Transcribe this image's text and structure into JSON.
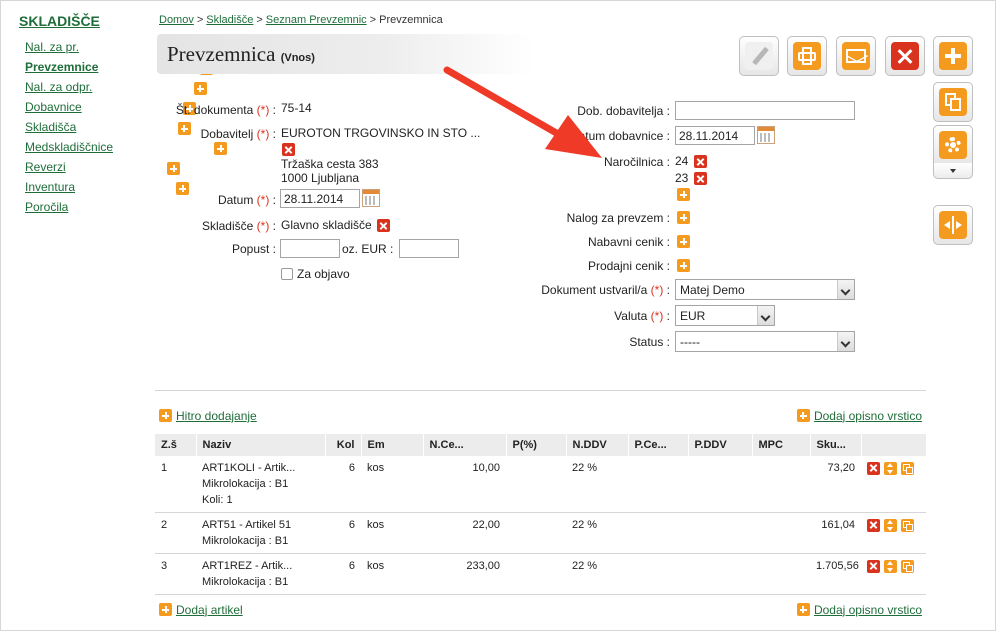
{
  "sidebar": {
    "title": "SKLADIŠČE",
    "items": [
      {
        "label": "Nal. za pr.",
        "plus": true,
        "active": false
      },
      {
        "label": "Prevzemnice",
        "plus": true,
        "active": true
      },
      {
        "label": "Nal. za odpr.",
        "plus": true,
        "active": false
      },
      {
        "label": "Dobavnice",
        "plus": true,
        "active": false
      },
      {
        "label": "Skladišča",
        "plus": true,
        "active": false
      },
      {
        "label": "Medskladiščnice",
        "plus": true,
        "active": false
      },
      {
        "label": "Reverzi",
        "plus": true,
        "active": false
      },
      {
        "label": "Inventura",
        "plus": true,
        "active": false
      },
      {
        "label": "Poročila",
        "plus": false,
        "active": false
      }
    ]
  },
  "breadcrumb": {
    "home": "Domov",
    "warehouse": "Skladišče",
    "list": "Seznam Prevzemnic",
    "current": "Prevzemnica",
    "separator": ">"
  },
  "page": {
    "title": "Prevzemnica",
    "subtitle": "(Vnos)"
  },
  "toolbar": {
    "edit_icon": "pencil-icon",
    "print_icon": "printer-icon",
    "email_icon": "envelope-icon",
    "delete_icon": "close-icon",
    "add_icon": "plus-icon",
    "copy_icon": "copy-icon",
    "settings_icon": "gear-icon",
    "split_icon": "split-icon"
  },
  "form": {
    "required_mark": "(*)",
    "doc_number": {
      "label": "Št. dokumenta",
      "value": "75-14"
    },
    "supplier": {
      "label": "Dobavitelj",
      "name": "EUROTON TRGOVINSKO IN STO ...",
      "address_line1": "Tržaška cesta 383",
      "address_line2": "1000 Ljubljana"
    },
    "date": {
      "label": "Datum",
      "value": "28.11.2014"
    },
    "warehouse": {
      "label": "Skladišče",
      "value": "Glavno skladišče"
    },
    "discount": {
      "label": "Popust :",
      "value": "",
      "eur_label": "oz. EUR :",
      "eur_value": ""
    },
    "publish": {
      "label": "Za objavo",
      "checked": false
    },
    "supplier_doc": {
      "label": "Dob. dobavitelja :",
      "value": ""
    },
    "delivery_date": {
      "label": "Datum dobavnice :",
      "label_visible": "tum dobavnice :",
      "label_prefix": "Da",
      "value": "28.11.2014"
    },
    "orders": {
      "label": "Naročilnica :",
      "values": [
        "24",
        "23"
      ]
    },
    "receipt_order": {
      "label": "Nalog za prevzem :"
    },
    "purchase_pricelist": {
      "label": "Nabavni cenik :"
    },
    "sales_pricelist": {
      "label": "Prodajni cenik :"
    },
    "created_by": {
      "label": "Dokument ustvaril/a",
      "value": "Matej Demo"
    },
    "currency": {
      "label": "Valuta",
      "value": "EUR"
    },
    "status": {
      "label": "Status :",
      "value": "-----"
    }
  },
  "links": {
    "quick_add": "Hitro dodajanje",
    "add_desc_row": "Dodaj opisno vrstico",
    "add_item": "Dodaj artikel"
  },
  "table": {
    "columns": [
      "Z.š",
      "Naziv",
      "Kol",
      "Em",
      "N.Ce...",
      "P(%)",
      "N.DDV",
      "P.Ce...",
      "P.DDV",
      "MPC",
      "Sku..."
    ],
    "rows": [
      {
        "zs": "1",
        "name": "ART1KOLI - Artik...",
        "extra": [
          "Mikrolokacija : B1",
          "Koli: 1"
        ],
        "qty": "6",
        "unit": "kos",
        "nprice": "10,00",
        "pct": "",
        "nvat": "22 %",
        "pprice": "",
        "pvat": "",
        "mpc": "",
        "total": "73,20"
      },
      {
        "zs": "2",
        "name": "ART51 - Artikel 51",
        "extra": [
          "Mikrolokacija : B1"
        ],
        "qty": "6",
        "unit": "kos",
        "nprice": "22,00",
        "pct": "",
        "nvat": "22 %",
        "pprice": "",
        "pvat": "",
        "mpc": "",
        "total": "161,04"
      },
      {
        "zs": "3",
        "name": "ART1REZ - Artik...",
        "extra": [
          "Mikrolokacija : B1"
        ],
        "qty": "6",
        "unit": "kos",
        "nprice": "233,00",
        "pct": "",
        "nvat": "22 %",
        "pprice": "",
        "pvat": "",
        "mpc": "",
        "total": "1.705,56"
      }
    ]
  },
  "colors": {
    "brand_green": "#1f6e3a",
    "accent_orange": "#f39a1f",
    "delete_red": "#d9331f",
    "arrow_red": "#ee3a26"
  }
}
